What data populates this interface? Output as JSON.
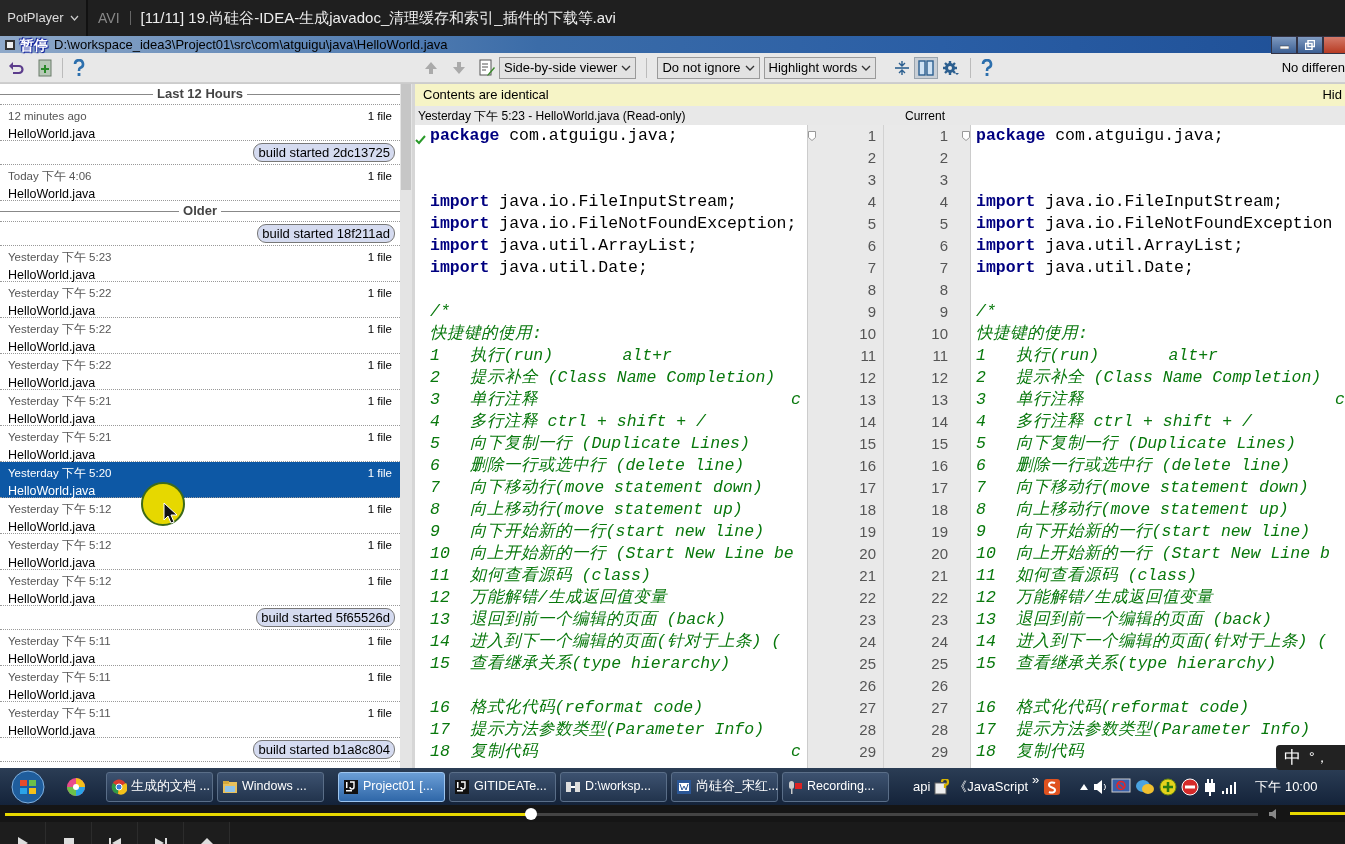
{
  "player": {
    "menu": "PotPlayer",
    "format": "AVI",
    "title": "[11/11] 19.尚硅谷-IDEA-生成javadoc_清理缓存和索引_插件的下载等.avi",
    "osd": "暂停",
    "seek": {
      "level": 0.42
    },
    "volume": {
      "level": 1
    }
  },
  "window": {
    "title": "D:\\workspace_idea3\\Project01\\src\\com\\atguigu\\java\\HelloWorld.java"
  },
  "diff_toolbar": {
    "viewer": "Side-by-side viewer",
    "ignore": "Do not ignore",
    "highlight": "Highlight words",
    "split_toggle": {
      "on": true
    },
    "status": "No differen"
  },
  "notification": {
    "text": "Contents are identical",
    "link": "Hid"
  },
  "history": {
    "items": [
      {
        "kind": "group",
        "label": "Last 12 Hours"
      },
      {
        "kind": "entry",
        "time": "12 minutes ago",
        "count": "1 file",
        "file": "HelloWorld.java",
        "selected": false
      },
      {
        "kind": "build",
        "label": "build started 2dc13725"
      },
      {
        "kind": "entry",
        "time": "Today 下午 4:06",
        "count": "1 file",
        "file": "HelloWorld.java",
        "selected": false
      },
      {
        "kind": "group",
        "label": "Older"
      },
      {
        "kind": "build",
        "label": "build started 18f211ad"
      },
      {
        "kind": "entry",
        "time": "Yesterday 下午 5:23",
        "count": "1 file",
        "file": "HelloWorld.java",
        "selected": false
      },
      {
        "kind": "entry",
        "time": "Yesterday 下午 5:22",
        "count": "1 file",
        "file": "HelloWorld.java",
        "selected": false
      },
      {
        "kind": "entry",
        "time": "Yesterday 下午 5:22",
        "count": "1 file",
        "file": "HelloWorld.java",
        "selected": false
      },
      {
        "kind": "entry",
        "time": "Yesterday 下午 5:22",
        "count": "1 file",
        "file": "HelloWorld.java",
        "selected": false
      },
      {
        "kind": "entry",
        "time": "Yesterday 下午 5:21",
        "count": "1 file",
        "file": "HelloWorld.java",
        "selected": false
      },
      {
        "kind": "entry",
        "time": "Yesterday 下午 5:21",
        "count": "1 file",
        "file": "HelloWorld.java",
        "selected": false
      },
      {
        "kind": "entry",
        "time": "Yesterday 下午 5:20",
        "count": "1 file",
        "file": "HelloWorld.java",
        "selected": true
      },
      {
        "kind": "entry",
        "time": "Yesterday 下午 5:12",
        "count": "1 file",
        "file": "HelloWorld.java",
        "selected": false
      },
      {
        "kind": "entry",
        "time": "Yesterday 下午 5:12",
        "count": "1 file",
        "file": "HelloWorld.java",
        "selected": false
      },
      {
        "kind": "entry",
        "time": "Yesterday 下午 5:12",
        "count": "1 file",
        "file": "HelloWorld.java",
        "selected": false
      },
      {
        "kind": "build",
        "label": "build started 5f65526d"
      },
      {
        "kind": "entry",
        "time": "Yesterday 下午 5:11",
        "count": "1 file",
        "file": "HelloWorld.java",
        "selected": false
      },
      {
        "kind": "entry",
        "time": "Yesterday 下午 5:11",
        "count": "1 file",
        "file": "HelloWorld.java",
        "selected": false
      },
      {
        "kind": "entry",
        "time": "Yesterday 下午 5:11",
        "count": "1 file",
        "file": "HelloWorld.java",
        "selected": false
      },
      {
        "kind": "build",
        "label": "build started b1a8c804"
      }
    ]
  },
  "left_header": "Yesterday 下午 5:23 - HelloWorld.java (Read-only)",
  "right_header": "Current",
  "left_editor": {
    "lines": [
      {
        "kind": "code",
        "text": "**package** com.atguigu.java;"
      },
      {
        "kind": "blank"
      },
      {
        "kind": "blank"
      },
      {
        "kind": "code",
        "text": "**import** java.io.FileInputStream;"
      },
      {
        "kind": "code",
        "text": "**import** java.io.FileNotFoundException;"
      },
      {
        "kind": "code",
        "text": "**import** java.util.ArrayList;"
      },
      {
        "kind": "code",
        "text": "**import** java.util.Date;"
      },
      {
        "kind": "blank"
      },
      {
        "kind": "comment",
        "text": "/*"
      },
      {
        "kind": "comment",
        "text": "快捷键的使用:"
      },
      {
        "kind": "comment",
        "text": "1   执行(run)       alt+r"
      },
      {
        "kind": "comment",
        "text": "2   提示补全 (Class Name Completion)"
      },
      {
        "kind": "comment",
        "text": "3   单行注释",
        "tail": "c"
      },
      {
        "kind": "comment",
        "text": "4   多行注释 ctrl + shift + /"
      },
      {
        "kind": "comment",
        "text": "5   向下复制一行 (Duplicate Lines)"
      },
      {
        "kind": "comment",
        "text": "6   删除一行或选中行 (delete line)"
      },
      {
        "kind": "comment",
        "text": "7   向下移动行(move statement down)"
      },
      {
        "kind": "comment",
        "text": "8   向上移动行(move statement up)"
      },
      {
        "kind": "comment",
        "text": "9   向下开始新的一行(start new line)"
      },
      {
        "kind": "comment",
        "text": "10  向上开始新的一行 (Start New Line be"
      },
      {
        "kind": "comment",
        "text": "11  如何查看源码 (class)"
      },
      {
        "kind": "comment",
        "text": "12  万能解错/生成返回值变量"
      },
      {
        "kind": "comment",
        "text": "13  退回到前一个编辑的页面 (back)"
      },
      {
        "kind": "comment",
        "text": "14  进入到下一个编辑的页面(针对于上条) ("
      },
      {
        "kind": "comment",
        "text": "15  查看继承关系(type hierarchy)"
      },
      {
        "kind": "blank"
      },
      {
        "kind": "comment",
        "text": "16  格式化代码(reformat code)"
      },
      {
        "kind": "comment",
        "text": "17  提示方法参数类型(Parameter Info)"
      },
      {
        "kind": "comment",
        "text": "18  复制代码",
        "tail": "c"
      }
    ]
  },
  "gutter": {
    "left_numbers": [
      "1",
      "2",
      "3",
      "4",
      "5",
      "6",
      "7",
      "8",
      "9",
      "10",
      "11",
      "12",
      "13",
      "14",
      "15",
      "16",
      "17",
      "18",
      "19",
      "20",
      "21",
      "22",
      "23",
      "24",
      "25",
      "26",
      "27",
      "28",
      "29"
    ],
    "right_numbers": [
      "1",
      "2",
      "3",
      "4",
      "5",
      "6",
      "7",
      "8",
      "9",
      "10",
      "11",
      "12",
      "13",
      "14",
      "15",
      "16",
      "17",
      "18",
      "19",
      "20",
      "21",
      "22",
      "23",
      "24",
      "25",
      "26",
      "27",
      "28",
      "29"
    ]
  },
  "right_editor": {
    "lines": [
      {
        "kind": "code",
        "text": "**package** com.atguigu.java;"
      },
      {
        "kind": "blank"
      },
      {
        "kind": "blank"
      },
      {
        "kind": "code",
        "text": "**import** java.io.FileInputStream;"
      },
      {
        "kind": "code",
        "text": "**import** java.io.FileNotFoundException"
      },
      {
        "kind": "code",
        "text": "**import** java.util.ArrayList;"
      },
      {
        "kind": "code",
        "text": "**import** java.util.Date;"
      },
      {
        "kind": "blank"
      },
      {
        "kind": "comment",
        "text": "/*"
      },
      {
        "kind": "comment",
        "text": "快捷键的使用:"
      },
      {
        "kind": "comment",
        "text": "1   执行(run)       alt+r"
      },
      {
        "kind": "comment",
        "text": "2   提示补全 (Class Name Completion)"
      },
      {
        "kind": "comment",
        "text": "3   单行注释",
        "tail": "c"
      },
      {
        "kind": "comment",
        "text": "4   多行注释 ctrl + shift + /"
      },
      {
        "kind": "comment",
        "text": "5   向下复制一行 (Duplicate Lines)"
      },
      {
        "kind": "comment",
        "text": "6   删除一行或选中行 (delete line)"
      },
      {
        "kind": "comment",
        "text": "7   向下移动行(move statement down)"
      },
      {
        "kind": "comment",
        "text": "8   向上移动行(move statement up)"
      },
      {
        "kind": "comment",
        "text": "9   向下开始新的一行(start new line)"
      },
      {
        "kind": "comment",
        "text": "10  向上开始新的一行 (Start New Line b"
      },
      {
        "kind": "comment",
        "text": "11  如何查看源码 (class)"
      },
      {
        "kind": "comment",
        "text": "12  万能解错/生成返回值变量"
      },
      {
        "kind": "comment",
        "text": "13  退回到前一个编辑的页面 (back)"
      },
      {
        "kind": "comment",
        "text": "14  进入到下一个编辑的页面(针对于上条) ("
      },
      {
        "kind": "comment",
        "text": "15  查看继承关系(type hierarchy)"
      },
      {
        "kind": "blank"
      },
      {
        "kind": "comment",
        "text": "16  格式化代码(reformat code)"
      },
      {
        "kind": "comment",
        "text": "17  提示方法参数类型(Parameter Info)"
      },
      {
        "kind": "comment",
        "text": "18  复制代码"
      }
    ]
  },
  "ime": {
    "mode": "中",
    "punct": "°，"
  },
  "taskbar": {
    "buttons": [
      {
        "label": "生成的文档 ...",
        "selected": false
      },
      {
        "label": "Windows ...",
        "selected": false
      },
      {
        "label": "Project01 [...",
        "selected": true
      },
      {
        "label": "GITIDEATe...",
        "selected": false
      },
      {
        "label": "D:\\worksp...",
        "selected": false
      },
      {
        "label": "尚硅谷_宋红...",
        "selected": false
      },
      {
        "label": "Recording...",
        "selected": false
      }
    ],
    "toolbar_items": [
      "api",
      "《JavaScript"
    ],
    "overflow": "»",
    "clock": "下午 10:00"
  }
}
